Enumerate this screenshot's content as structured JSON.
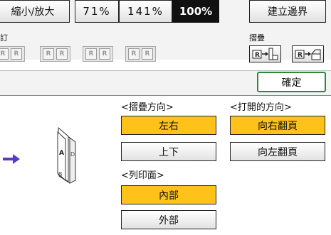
{
  "top_buttons": {
    "reduce_enlarge": "縮小/放大",
    "zoom_71": "71%",
    "zoom_141": "141%",
    "zoom_100": "100%",
    "create_margin": "建立邊界"
  },
  "staple_label": "訂",
  "fold_label": "摺疊",
  "staple_icons": [
    "R",
    "R",
    "R",
    "R",
    "R",
    "R",
    "R",
    "R"
  ],
  "fold_icon_letter": "R",
  "confirm": "確定",
  "fold_direction": {
    "title": "<摺疊方向>",
    "options": [
      "左右",
      "上下"
    ],
    "selected": "左右"
  },
  "open_direction": {
    "title": "<打開的方向>",
    "options": [
      "向右翻頁",
      "向左翻頁"
    ],
    "selected": "向右翻頁"
  },
  "print_side": {
    "title": "<列印面>",
    "options": [
      "內部",
      "外部"
    ],
    "selected": "內部"
  },
  "illustration": {
    "page_a": "A",
    "page_b": "B",
    "page_d": "D"
  },
  "colors": {
    "selected": "#ffc21a",
    "arrow": "#5b39c9",
    "confirm_border": "#2a8a3a"
  }
}
